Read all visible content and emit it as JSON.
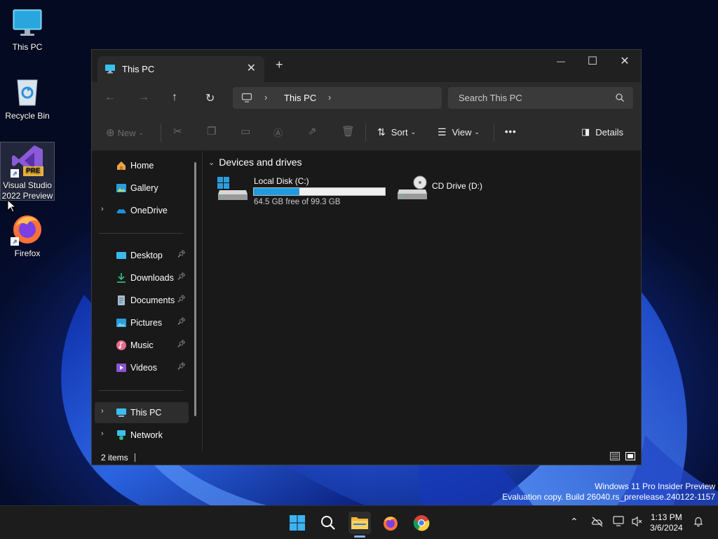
{
  "desktop": {
    "icons": [
      {
        "label": "This PC"
      },
      {
        "label": "Recycle Bin"
      },
      {
        "label": "Visual Studio 2022 Preview",
        "badge": "PRE"
      },
      {
        "label": "Firefox"
      }
    ]
  },
  "window": {
    "tab_title": "This PC",
    "new_tab": "+",
    "controls": {
      "minimize": "—",
      "maximize": "☐",
      "close": "✕"
    },
    "address": {
      "segment": "This PC"
    },
    "search_placeholder": "Search This PC",
    "toolbar": {
      "new": "New",
      "sort": "Sort",
      "view": "View",
      "more": "•••",
      "details": "Details"
    },
    "sidebar": {
      "items": [
        {
          "label": "Home"
        },
        {
          "label": "Gallery"
        },
        {
          "label": "OneDrive"
        },
        {
          "label": "Desktop"
        },
        {
          "label": "Downloads"
        },
        {
          "label": "Documents"
        },
        {
          "label": "Pictures"
        },
        {
          "label": "Music"
        },
        {
          "label": "Videos"
        },
        {
          "label": "This PC"
        },
        {
          "label": "Network"
        }
      ]
    },
    "content": {
      "group_header": "Devices and drives",
      "drives": [
        {
          "name": "Local Disk (C:)",
          "free_text": "64.5 GB free of 99.3 GB",
          "used_fraction": 0.35
        },
        {
          "name": "CD Drive (D:)"
        }
      ]
    },
    "status": {
      "items": "2 items"
    }
  },
  "watermark": {
    "line1": "Windows 11 Pro Insider Preview",
    "line2": "Evaluation copy. Build 26040.rs_prerelease.240122-1157"
  },
  "taskbar": {
    "time": "1:13 PM",
    "date": "3/6/2024"
  },
  "colors": {
    "accent": "#1e9be0",
    "window_bg": "#191919",
    "taskbar_bg": "#1c1c1c"
  }
}
